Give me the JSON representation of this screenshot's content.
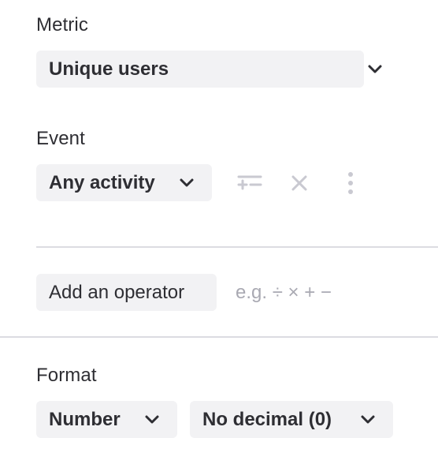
{
  "metric": {
    "label": "Metric",
    "selected": "Unique users"
  },
  "event": {
    "label": "Event",
    "selected": "Any activity",
    "icons": [
      "filter-add-icon",
      "close-icon",
      "more-vertical-icon"
    ]
  },
  "operator": {
    "button_label": "Add an operator",
    "hint": "e.g. ÷ × + −"
  },
  "format": {
    "label": "Format",
    "type_selected": "Number",
    "decimal_selected": "No decimal (0)"
  },
  "colors": {
    "button_bg": "#f2f2f4",
    "text": "#2e2e33",
    "muted": "#a9a9b2",
    "icon_disabled": "#c9c9d1",
    "divider": "#dcdce2"
  }
}
